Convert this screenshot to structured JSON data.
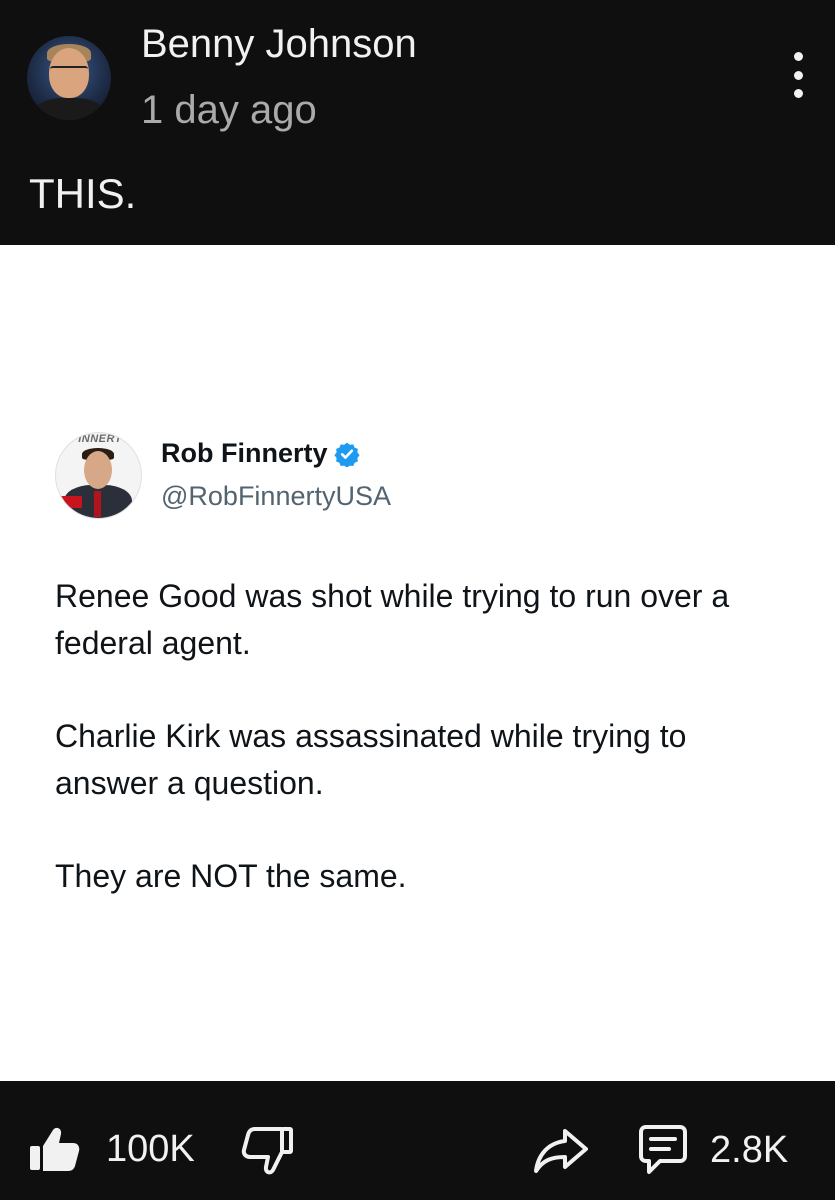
{
  "post": {
    "author": "Benny Johnson",
    "time": "1 day ago",
    "text": "THIS."
  },
  "tweet": {
    "avatar_logo": "FINNERTY",
    "name": "Rob Finnerty",
    "handle": "@RobFinnertyUSA",
    "paragraphs": [
      "Renee Good was shot while trying to run over a federal agent.",
      "Charlie Kirk was assassinated while trying to answer a question.",
      "They are NOT the same."
    ],
    "verified_color": "#1d9bf0"
  },
  "actions": {
    "likes": "100K",
    "comments": "2.8K"
  },
  "icons": {
    "menu": "more-vert-icon",
    "like": "thumbs-up-icon",
    "dislike": "thumbs-down-icon",
    "share": "share-icon",
    "comment": "comment-icon"
  }
}
